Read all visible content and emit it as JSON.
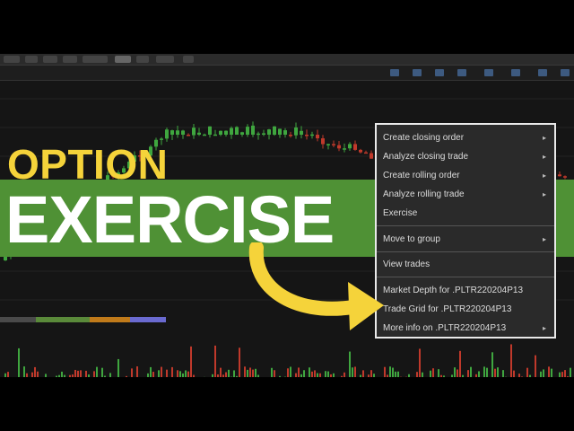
{
  "promo": {
    "headline_top": "OPTION",
    "headline_main": "EXERCISE",
    "top_color": "#f5d33a",
    "banner_color": "#4f9135"
  },
  "context_menu": {
    "items": [
      {
        "label": "Create closing order",
        "submenu": true
      },
      {
        "label": "Analyze closing trade",
        "submenu": true
      },
      {
        "label": "Create rolling order",
        "submenu": true
      },
      {
        "label": "Analyze rolling trade",
        "submenu": true
      },
      {
        "label": "Exercise",
        "submenu": false
      },
      {
        "label": "Move to group",
        "submenu": true
      },
      {
        "label": "View trades",
        "submenu": false
      },
      {
        "label": "Market Depth for .PLTR220204P13",
        "submenu": false
      },
      {
        "label": "Trade Grid for .PLTR220204P13",
        "submenu": false
      },
      {
        "label": "More info on .PLTR220204P13",
        "submenu": true
      }
    ],
    "submenu_arrow": "▸"
  },
  "colors": {
    "up_candle": "#3fa63f",
    "down_candle": "#c0392b",
    "arrow": "#f5d33a"
  },
  "icons": [
    "chevron-right-icon",
    "curved-arrow-icon"
  ]
}
